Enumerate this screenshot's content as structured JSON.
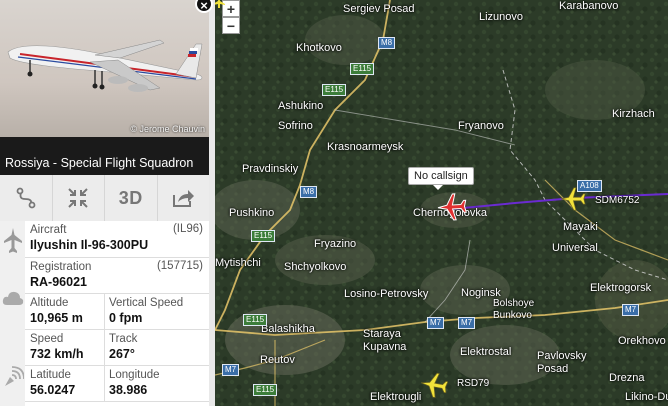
{
  "panel": {
    "photo_credit": "© Jerome Chauvin",
    "airline_title": "Rossiya - Special Flight Squadron",
    "toolbar": {
      "btn_3d": "3D"
    },
    "aircraft": {
      "label": "Aircraft",
      "code": "(IL96)",
      "value": "Ilyushin Il-96-300PU"
    },
    "registration": {
      "label": "Registration",
      "code": "(157715)",
      "value": "RA-96021"
    },
    "altitude": {
      "label": "Altitude",
      "value": "10,965 m"
    },
    "vertical_speed": {
      "label": "Vertical Speed",
      "value": "0 fpm"
    },
    "speed": {
      "label": "Speed",
      "value": "732 km/h"
    },
    "track": {
      "label": "Track",
      "value": "267°"
    },
    "latitude": {
      "label": "Latitude",
      "value": "56.0247"
    },
    "longitude": {
      "label": "Longitude",
      "value": "38.986"
    }
  },
  "map": {
    "zoom_in": "+",
    "zoom_out": "−",
    "selected_callsign": "No callsign",
    "flights": [
      "SDM6752",
      "RSD79"
    ],
    "cities": [
      "Sergiev Posad",
      "Lizunovo",
      "Karabanovo",
      "Khotkovo",
      "Ashukino",
      "Sofrino",
      "Fryanovo",
      "Kirzhach",
      "Krasnoarmeysk",
      "Pravdinskiy",
      "Chernogolovka",
      "Mayaki",
      "Universal",
      "Pushkino",
      "Fryazino",
      "Mytishchi",
      "Shchyolkovo",
      "Elektrogorsk",
      "Losino-Petrovsky",
      "Noginsk",
      "Bolshoye Bunkovo",
      "Balashikha",
      "Staraya Kupavna",
      "Orekhovo",
      "Reutov",
      "Elektrostal",
      "Pavlovsky Posad",
      "Drezna",
      "Likino-Dulyovo",
      "Elektrougli"
    ],
    "roads": [
      "M8",
      "E115",
      "A108",
      "M7"
    ],
    "colors": {
      "selected_plane": "#e03030",
      "other_planes": "#f1e23a",
      "track": "#6a2bd1",
      "forest": "#2c3b28"
    }
  }
}
